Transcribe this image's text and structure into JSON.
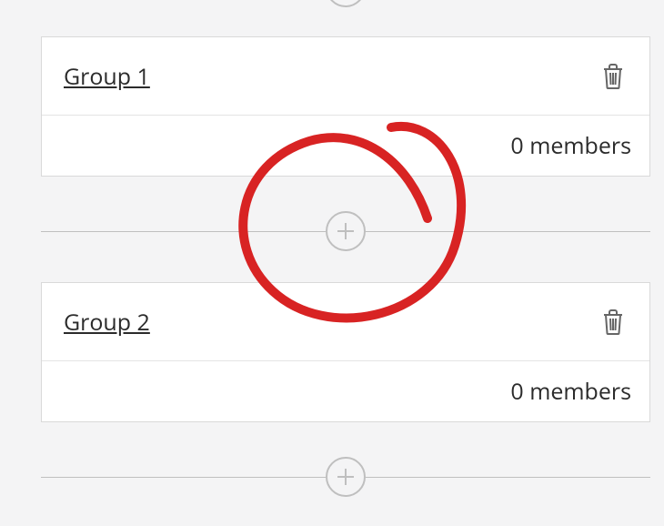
{
  "groups": [
    {
      "title": "Group 1",
      "members_text": "0 members"
    },
    {
      "title": "Group 2",
      "members_text": "0 members"
    }
  ],
  "icons": {
    "plus": "plus-icon",
    "trash": "trash-icon"
  },
  "annotation": {
    "color": "#d82323",
    "present": true,
    "target": "add-group-button-middle"
  }
}
